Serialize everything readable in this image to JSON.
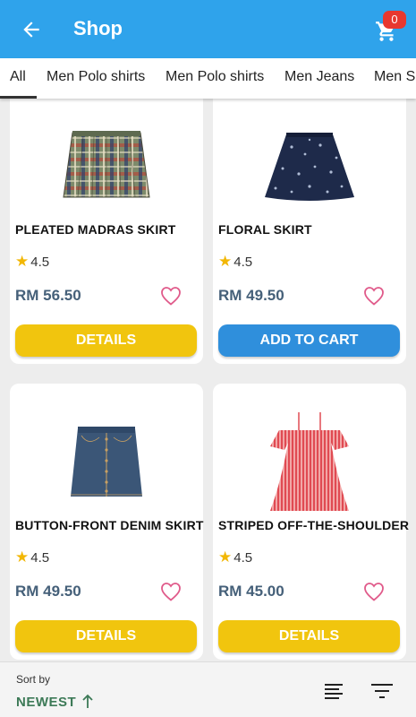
{
  "app_bar": {
    "title": "Shop",
    "back_icon": "arrow-left-icon",
    "cart_icon": "cart-icon",
    "cart_count": "0",
    "color": "#2fa3eb"
  },
  "tabs": [
    {
      "label": "All",
      "active": true
    },
    {
      "label": "Men Polo shirts"
    },
    {
      "label": "Men Polo shirts"
    },
    {
      "label": "Men Jeans"
    },
    {
      "label": "Men Sh"
    }
  ],
  "products": [
    {
      "name": "PLEATED MADRAS SKIRT",
      "rating": "4.5",
      "price": "RM 56.50",
      "button": "DETAILS"
    },
    {
      "name": "FLORAL SKIRT",
      "rating": "4.5",
      "price": "RM 49.50",
      "button": "ADD TO CART"
    },
    {
      "name": "BUTTON-FRONT DENIM SKIRT",
      "rating": "4.5",
      "price": "RM 49.50",
      "button": "DETAILS"
    },
    {
      "name": "STRIPED OFF-THE-SHOULDER",
      "rating": "4.5",
      "price": "RM 45.00",
      "button": "DETAILS"
    }
  ],
  "sort": {
    "label": "Sort by",
    "value": "NEWEST"
  },
  "colors": {
    "details_button": "#f1c50e",
    "cart_button": "#2f8fdc",
    "price": "#456079",
    "sort_value": "#3d7a57",
    "heart": "#e05a8a"
  }
}
